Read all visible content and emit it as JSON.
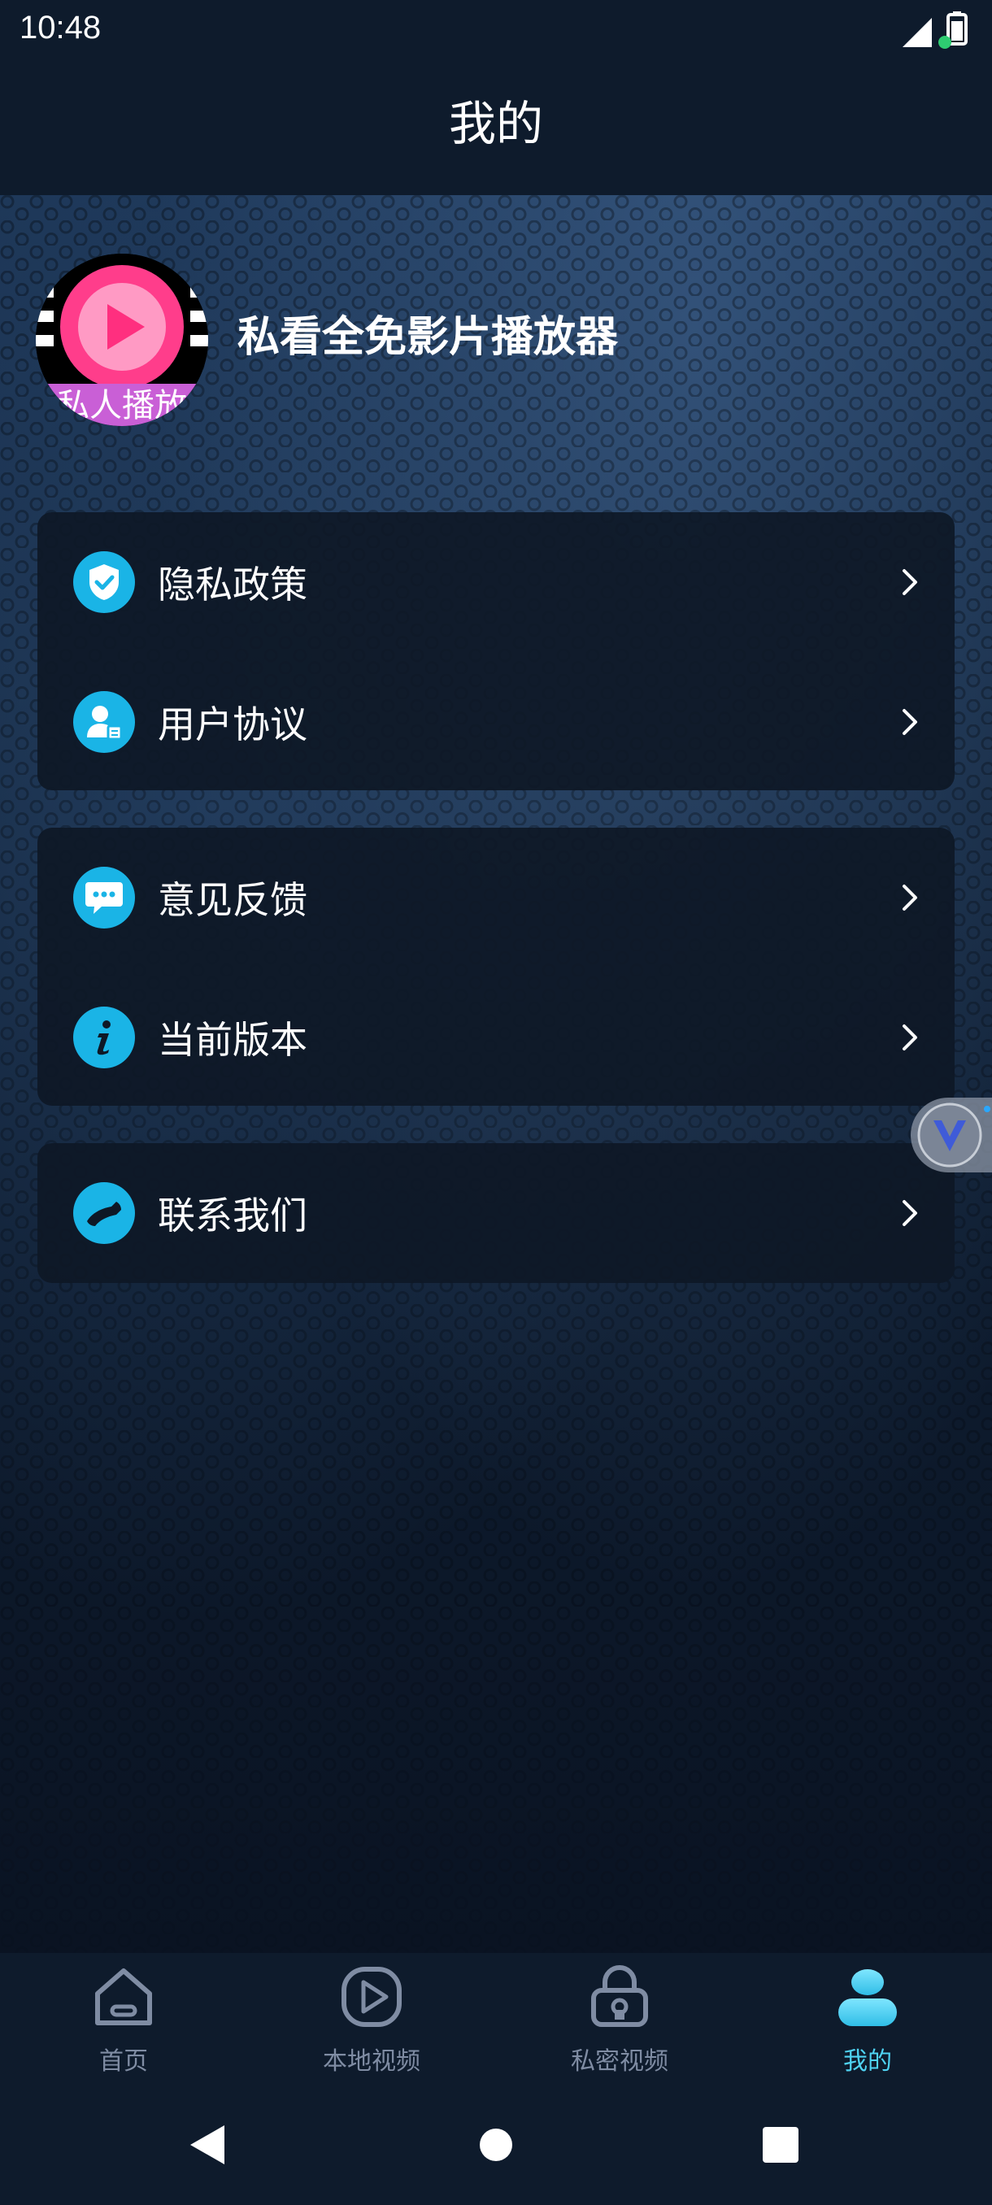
{
  "status_bar": {
    "time": "10:48"
  },
  "header": {
    "title": "我的"
  },
  "profile": {
    "app_name": "私看全免影片播放器",
    "avatar_text": "私人播放"
  },
  "menu_groups": [
    {
      "items": [
        {
          "label": "隐私政策",
          "icon": "shield-check-icon"
        },
        {
          "label": "用户协议",
          "icon": "user-document-icon"
        }
      ]
    },
    {
      "items": [
        {
          "label": "意见反馈",
          "icon": "chat-bubble-icon"
        },
        {
          "label": "当前版本",
          "icon": "info-icon"
        }
      ]
    },
    {
      "items": [
        {
          "label": "联系我们",
          "icon": "phone-icon"
        }
      ]
    }
  ],
  "bottom_nav": [
    {
      "label": "首页",
      "icon": "home-icon",
      "active": false
    },
    {
      "label": "本地视频",
      "icon": "play-icon",
      "active": false
    },
    {
      "label": "私密视频",
      "icon": "lock-icon",
      "active": false
    },
    {
      "label": "我的",
      "icon": "person-icon",
      "active": true
    }
  ],
  "colors": {
    "accent": "#1ab4e6",
    "active_nav": "#4fd3f2",
    "inactive_nav": "#7f8ca3",
    "header_bg": "#0e1b2c",
    "card_bg": "#0e1826"
  }
}
